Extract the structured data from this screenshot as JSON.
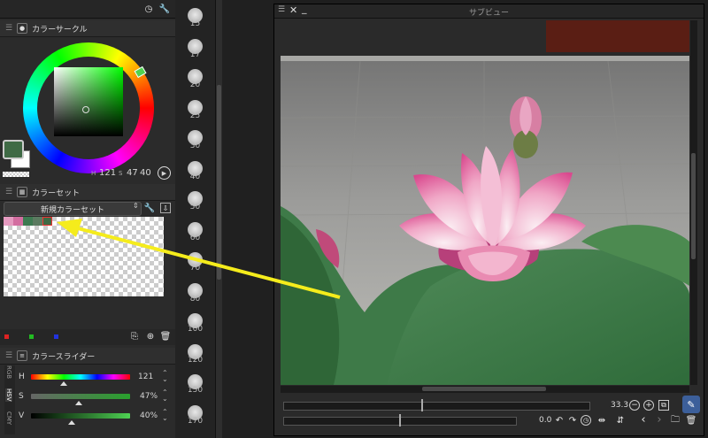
{
  "color_circle": {
    "title": "カラーサークル",
    "hue": "121",
    "saturation": "47",
    "value": "40",
    "main_color": "#3f6a45",
    "sub_color": "#ffffff"
  },
  "color_set": {
    "title": "カラーセット",
    "set_name": "新規カラーセット",
    "swatches": [
      "#e59bc0",
      "#d36ea0",
      "#3d7a51",
      "#5b7a60",
      "#c7a7a7"
    ]
  },
  "color_slider": {
    "title": "カラースライダー",
    "modes": [
      "RGB",
      "HSV",
      "CMY"
    ],
    "rows": [
      {
        "label": "H",
        "value": "121"
      },
      {
        "label": "S",
        "value": "47%"
      },
      {
        "label": "V",
        "value": "40%"
      }
    ]
  },
  "brush_sizes": [
    "15",
    "17",
    "20",
    "25",
    "30",
    "40",
    "50",
    "60",
    "70",
    "80",
    "100",
    "120",
    "150",
    "170"
  ],
  "sub_view": {
    "title": "サブビュー",
    "zoom": "33.3",
    "rotation": "0.0"
  },
  "colors": {
    "annotation_arrow": "#f5ec1c",
    "panel_bg": "#2b2b2b"
  }
}
